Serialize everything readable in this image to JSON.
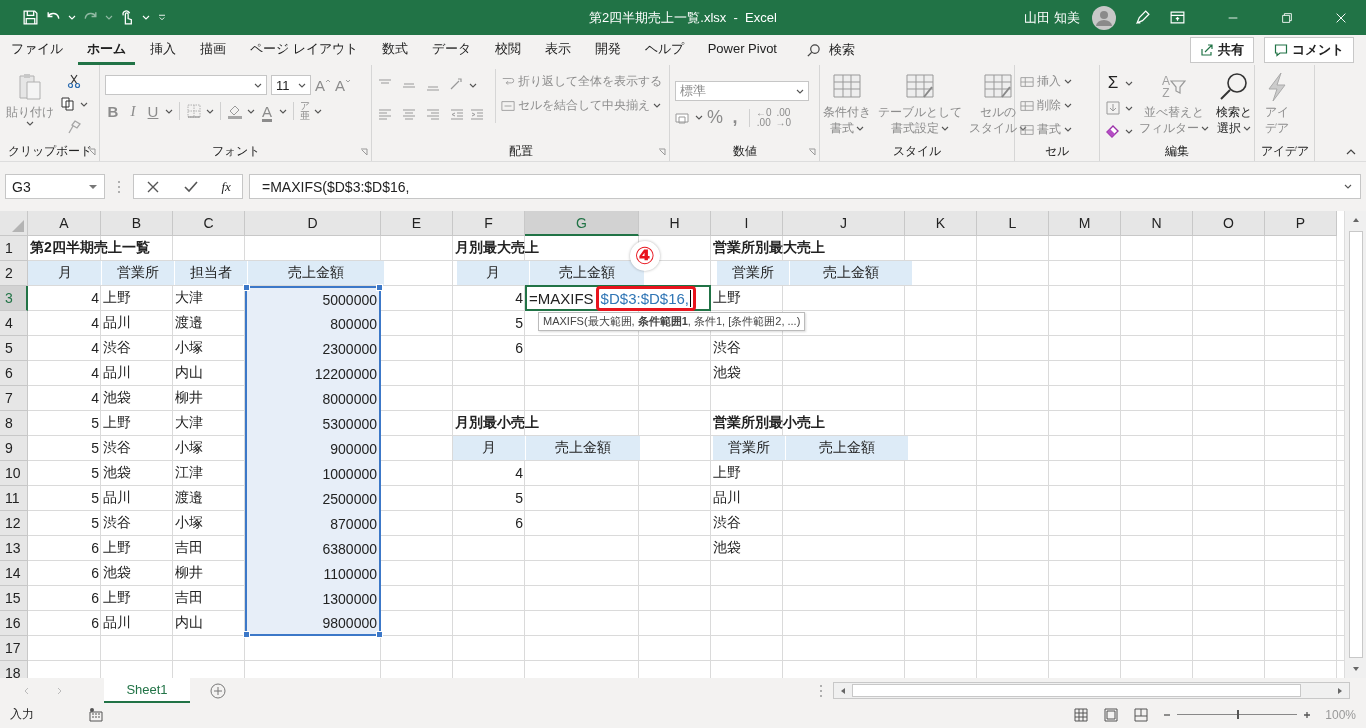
{
  "title_bar": {
    "title": "第2四半期売上一覧.xlsx  -  Excel",
    "user": "山田 知美"
  },
  "menu_tabs": [
    {
      "label": "ファイル",
      "selected": false
    },
    {
      "label": "ホーム",
      "selected": true
    },
    {
      "label": "挿入",
      "selected": false
    },
    {
      "label": "描画",
      "selected": false
    },
    {
      "label": "ページ レイアウト",
      "selected": false
    },
    {
      "label": "数式",
      "selected": false
    },
    {
      "label": "データ",
      "selected": false
    },
    {
      "label": "校閲",
      "selected": false
    },
    {
      "label": "表示",
      "selected": false
    },
    {
      "label": "開発",
      "selected": false
    },
    {
      "label": "ヘルプ",
      "selected": false
    },
    {
      "label": "Power Pivot",
      "selected": false
    }
  ],
  "search": {
    "label": "検索"
  },
  "share_button": "共有",
  "comment_button": "コメント",
  "ribbon": {
    "clipboard": {
      "label": "クリップボード",
      "paste": {
        "label": "貼り付け",
        "disabled": true
      }
    },
    "font": {
      "label": "フォント",
      "size": "11",
      "grow": "A",
      "shrink": "A",
      "bold": "B",
      "italic": "I",
      "underline": "U",
      "font_color_glyph": "A",
      "phonetic": [
        "ア",
        "亜"
      ]
    },
    "alignment": {
      "label": "配置",
      "wrap": {
        "label": "折り返して全体を表示する",
        "disabled": true
      },
      "merge": {
        "label": "セルを結合して中央揃え",
        "disabled": true
      }
    },
    "number": {
      "label": "数値",
      "format": "標準",
      "percent": "%",
      "comma": ",",
      "increase_decimal": [
        "←0",
        ".00"
      ],
      "decrease_decimal": [
        ".00",
        "→0"
      ]
    },
    "styles": {
      "label": "スタイル",
      "conditional": {
        "lines": [
          "条件付き",
          "書式"
        ],
        "disabled": true
      },
      "table": {
        "lines": [
          "テーブルとして",
          "書式設定"
        ],
        "disabled": true
      },
      "cell": {
        "lines": [
          "セルの",
          "スタイル"
        ],
        "disabled": true
      }
    },
    "cells": {
      "label": "セル",
      "insert": {
        "label": "挿入",
        "disabled": true
      },
      "delete": {
        "label": "削除",
        "disabled": true
      },
      "format": {
        "label": "書式",
        "disabled": true
      }
    },
    "editing": {
      "label": "編集",
      "sum": "Σ",
      "sort_glyph": [
        "A",
        "Z"
      ],
      "sort": {
        "lines": [
          "並べ替えと",
          "フィルター"
        ],
        "disabled": true
      },
      "find": {
        "lines": [
          "検索と",
          "選択"
        ],
        "disabled": false
      }
    },
    "ideas": {
      "label": "アイデア",
      "ideas": {
        "lines": [
          "アイ",
          "デア"
        ],
        "disabled": true
      }
    }
  },
  "formula_bar": {
    "name_box": "G3",
    "fx": "fx",
    "formula": "=MAXIFS($D$3:$D$16,"
  },
  "columns": [
    "A",
    "B",
    "C",
    "D",
    "E",
    "F",
    "G",
    "H",
    "I",
    "J",
    "K",
    "L",
    "M",
    "N",
    "O",
    "P"
  ],
  "rows": [
    {
      "number": "1",
      "cells": [
        {
          "v": "第2四半期売上一覧",
          "kind": "title"
        },
        {},
        {},
        {},
        {},
        {
          "v": "月別最大売上",
          "kind": "title"
        },
        {},
        {},
        {
          "v": "営業所別最大売上",
          "kind": "title"
        }
      ]
    },
    {
      "number": "2",
      "cells": [
        {
          "v": "月",
          "kind": "head"
        },
        {
          "v": "営業所",
          "kind": "head"
        },
        {
          "v": "担当者",
          "kind": "head"
        },
        {
          "v": "売上金額",
          "kind": "head"
        },
        {},
        {
          "v": "月",
          "kind": "head"
        },
        {
          "v": "売上金額",
          "kind": "head"
        },
        {},
        {
          "v": "営業所",
          "kind": "head"
        },
        {
          "v": "売上金額",
          "kind": "head"
        }
      ]
    },
    {
      "number": "3",
      "cells": [
        {
          "v": "4",
          "kind": "num"
        },
        {
          "v": "上野",
          "kind": "txt"
        },
        {
          "v": "大津",
          "kind": "txt"
        },
        {
          "v": "5000000",
          "kind": "num",
          "selected": true
        },
        {},
        {
          "v": "4",
          "kind": "num"
        },
        {
          "v": "=MAXIFS",
          "ref": "$D$3:$D$16,",
          "kind": "edit",
          "active": true,
          "step": "④",
          "hint": "MAXIFS(最大範囲, **条件範囲1**, 条件1, [条件範囲2, ...)"
        },
        {},
        {
          "v": "上野",
          "kind": "txt"
        }
      ]
    },
    {
      "number": "4",
      "cells": [
        {
          "v": "4",
          "kind": "num"
        },
        {
          "v": "品川",
          "kind": "txt"
        },
        {
          "v": "渡邉",
          "kind": "txt"
        },
        {
          "v": "800000",
          "kind": "num",
          "selected": true
        },
        {},
        {
          "v": "5",
          "kind": "num"
        }
      ]
    },
    {
      "number": "5",
      "cells": [
        {
          "v": "4",
          "kind": "num"
        },
        {
          "v": "渋谷",
          "kind": "txt"
        },
        {
          "v": "小塚",
          "kind": "txt"
        },
        {
          "v": "2300000",
          "kind": "num",
          "selected": true
        },
        {},
        {
          "v": "6",
          "kind": "num"
        },
        {},
        {},
        {
          "v": "渋谷",
          "kind": "txt"
        }
      ]
    },
    {
      "number": "6",
      "cells": [
        {
          "v": "4",
          "kind": "num"
        },
        {
          "v": "品川",
          "kind": "txt"
        },
        {
          "v": "内山",
          "kind": "txt"
        },
        {
          "v": "12200000",
          "kind": "num",
          "selected": true
        },
        {},
        {},
        {},
        {},
        {
          "v": "池袋",
          "kind": "txt"
        }
      ]
    },
    {
      "number": "7",
      "cells": [
        {
          "v": "4",
          "kind": "num"
        },
        {
          "v": "池袋",
          "kind": "txt"
        },
        {
          "v": "柳井",
          "kind": "txt"
        },
        {
          "v": "8000000",
          "kind": "num",
          "selected": true
        }
      ]
    },
    {
      "number": "8",
      "cells": [
        {
          "v": "5",
          "kind": "num"
        },
        {
          "v": "上野",
          "kind": "txt"
        },
        {
          "v": "大津",
          "kind": "txt"
        },
        {
          "v": "5300000",
          "kind": "num",
          "selected": true
        },
        {},
        {
          "v": "月別最小売上",
          "kind": "title"
        },
        {},
        {},
        {
          "v": "営業所別最小売上",
          "kind": "title"
        }
      ]
    },
    {
      "number": "9",
      "cells": [
        {
          "v": "5",
          "kind": "num"
        },
        {
          "v": "渋谷",
          "kind": "txt"
        },
        {
          "v": "小塚",
          "kind": "txt"
        },
        {
          "v": "900000",
          "kind": "num",
          "selected": true
        },
        {},
        {
          "v": "月",
          "kind": "head"
        },
        {
          "v": "売上金額",
          "kind": "head"
        },
        {},
        {
          "v": "営業所",
          "kind": "head"
        },
        {
          "v": "売上金額",
          "kind": "head"
        }
      ]
    },
    {
      "number": "10",
      "cells": [
        {
          "v": "5",
          "kind": "num"
        },
        {
          "v": "池袋",
          "kind": "txt"
        },
        {
          "v": "江津",
          "kind": "txt"
        },
        {
          "v": "1000000",
          "kind": "num",
          "selected": true
        },
        {},
        {
          "v": "4",
          "kind": "num"
        },
        {},
        {},
        {
          "v": "上野",
          "kind": "txt"
        }
      ]
    },
    {
      "number": "11",
      "cells": [
        {
          "v": "5",
          "kind": "num"
        },
        {
          "v": "品川",
          "kind": "txt"
        },
        {
          "v": "渡邉",
          "kind": "txt"
        },
        {
          "v": "2500000",
          "kind": "num",
          "selected": true
        },
        {},
        {
          "v": "5",
          "kind": "num"
        },
        {},
        {},
        {
          "v": "品川",
          "kind": "txt"
        }
      ]
    },
    {
      "number": "12",
      "cells": [
        {
          "v": "5",
          "kind": "num"
        },
        {
          "v": "渋谷",
          "kind": "txt"
        },
        {
          "v": "小塚",
          "kind": "txt"
        },
        {
          "v": "870000",
          "kind": "num",
          "selected": true
        },
        {},
        {
          "v": "6",
          "kind": "num"
        },
        {},
        {},
        {
          "v": "渋谷",
          "kind": "txt"
        }
      ]
    },
    {
      "number": "13",
      "cells": [
        {
          "v": "6",
          "kind": "num"
        },
        {
          "v": "上野",
          "kind": "txt"
        },
        {
          "v": "吉田",
          "kind": "txt"
        },
        {
          "v": "6380000",
          "kind": "num",
          "selected": true
        },
        {},
        {},
        {},
        {},
        {
          "v": "池袋",
          "kind": "txt"
        }
      ]
    },
    {
      "number": "14",
      "cells": [
        {
          "v": "6",
          "kind": "num"
        },
        {
          "v": "池袋",
          "kind": "txt"
        },
        {
          "v": "柳井",
          "kind": "txt"
        },
        {
          "v": "1100000",
          "kind": "num",
          "selected": true
        }
      ]
    },
    {
      "number": "15",
      "cells": [
        {
          "v": "6",
          "kind": "num"
        },
        {
          "v": "上野",
          "kind": "txt"
        },
        {
          "v": "吉田",
          "kind": "txt"
        },
        {
          "v": "1300000",
          "kind": "num",
          "selected": true
        }
      ]
    },
    {
      "number": "16",
      "cells": [
        {
          "v": "6",
          "kind": "num"
        },
        {
          "v": "品川",
          "kind": "txt"
        },
        {
          "v": "内山",
          "kind": "txt"
        },
        {
          "v": "9800000",
          "kind": "num",
          "selected": true
        }
      ]
    },
    {
      "number": "17",
      "cells": []
    },
    {
      "number": "18",
      "cells": []
    }
  ],
  "sheet_tabs": [
    {
      "label": "Sheet1",
      "selected": true
    }
  ],
  "status_bar": {
    "mode": "入力",
    "zoom": {
      "label": "100%",
      "level": 0.5
    }
  }
}
